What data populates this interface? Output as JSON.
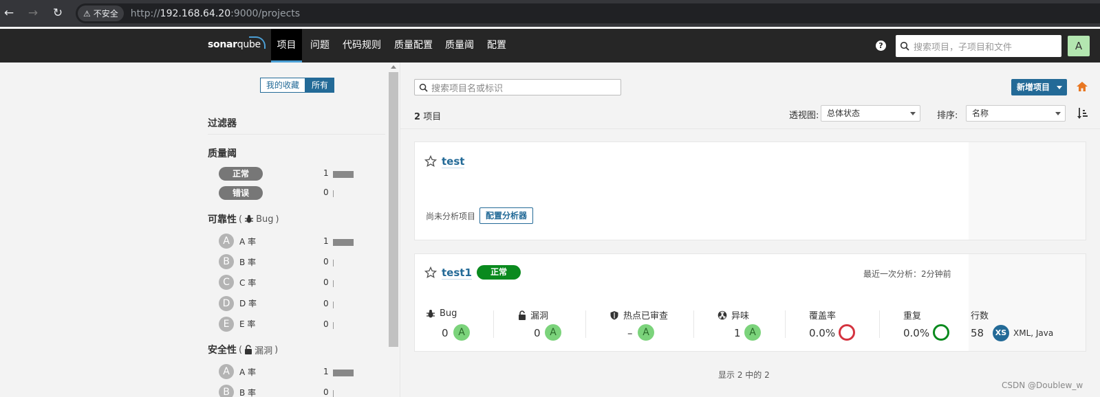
{
  "browser": {
    "insecure_label": "不安全",
    "url_scheme": "http://",
    "url_host": "192.168.64.20",
    "url_rest": ":9000/projects"
  },
  "nav": {
    "logo_bold": "sonar",
    "logo_light": "qube",
    "items": [
      "项目",
      "问题",
      "代码规则",
      "质量配置",
      "质量阈",
      "配置"
    ],
    "active_index": 0,
    "help": "?",
    "search_placeholder": "搜索项目，子项目和文件",
    "avatar_letter": "A"
  },
  "sidebar": {
    "toggle": [
      "我的收藏",
      "所有"
    ],
    "filters_title": "过滤器",
    "quality_gate": {
      "title": "质量阈",
      "items": [
        {
          "label": "正常",
          "count": "1",
          "bar": 1.0
        },
        {
          "label": "错误",
          "count": "0",
          "bar": 0
        }
      ]
    },
    "reliability": {
      "title": "可靠性",
      "sub": "Bug",
      "items": [
        {
          "letter": "A",
          "label": "A 率",
          "count": "1",
          "bar": 1.0
        },
        {
          "letter": "B",
          "label": "B 率",
          "count": "0",
          "bar": 0
        },
        {
          "letter": "C",
          "label": "C 率",
          "count": "0",
          "bar": 0
        },
        {
          "letter": "D",
          "label": "D 率",
          "count": "0",
          "bar": 0
        },
        {
          "letter": "E",
          "label": "E 率",
          "count": "0",
          "bar": 0
        }
      ]
    },
    "security": {
      "title": "安全性",
      "sub": "漏洞",
      "items": [
        {
          "letter": "A",
          "label": "A 率",
          "count": "1",
          "bar": 1.0
        },
        {
          "letter": "B",
          "label": "B 率",
          "count": "0",
          "bar": 0
        }
      ]
    }
  },
  "main": {
    "search_placeholder": "搜索项目名或标识",
    "new_project": "新增项目",
    "count_number": "2",
    "count_label": "项目",
    "perspective_label": "透视图:",
    "perspective_value": "总体状态",
    "sort_label": "排序:",
    "sort_value": "名称",
    "pagination": "显示 2 中的 2"
  },
  "projects": [
    {
      "name": "test",
      "not_analyzed": "尚未分析项目",
      "configure_button": "配置分析器"
    },
    {
      "name": "test1",
      "status": "正常",
      "last_analysis": "最近一次分析：2分钟前",
      "measures": {
        "bug_label": "Bug",
        "bug_value": "0",
        "bug_grade": "A",
        "vuln_label": "漏洞",
        "vuln_value": "0",
        "vuln_grade": "A",
        "hotspot_label": "热点已审查",
        "hotspot_value": "–",
        "hotspot_grade": "A",
        "smell_label": "异味",
        "smell_value": "1",
        "smell_grade": "A",
        "coverage_label": "覆盖率",
        "coverage_value": "0.0%",
        "dup_label": "重复",
        "dup_value": "0.0%",
        "lines_label": "行数",
        "lines_value": "58",
        "size": "XS",
        "languages": "XML, Java"
      }
    }
  ],
  "watermark": "CSDN @Doublew_w",
  "colors": {
    "accent": "#236a97",
    "grade_a": "#7bd37b",
    "status_ok": "#0a8a1e",
    "coverage_ring": "#d4333f",
    "dup_ring": "#0a8a1e"
  }
}
